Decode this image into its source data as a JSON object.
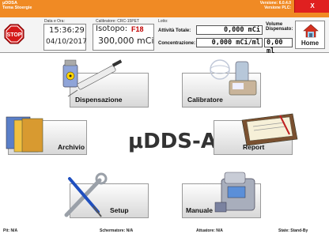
{
  "titlebar": {
    "app_name": "μDDSA",
    "subtitle": "Tema Stoergie",
    "version": "Versione: 6.0.4.0",
    "plc_version": "Versione PLC:",
    "close_label": "X"
  },
  "info": {
    "datetime_label": "Data e Ora:",
    "time": "15:36:29",
    "date": "04/10/2017",
    "calibrator_label": "Calibratore: CRC-15PET",
    "isotope_label": "Isotopo:",
    "isotope_value": "F18",
    "activity": "300,000 mCi",
    "lot_label": "Lotto:",
    "total_activity_label": "Attività Totale:",
    "total_activity_value": "0,000 mCi",
    "volume_label": "Volume Dispensato:",
    "concentration_label": "Concentrazione:",
    "concentration_value": "0,000 mCi/ml",
    "volume_value": "0,00 ml",
    "home_label": "Home"
  },
  "buttons": {
    "dispensazione": "Dispensazione",
    "calibratore": "Calibratore",
    "archivio": "Archivio",
    "report": "Report",
    "setup": "Setup",
    "manuale": "Manuale"
  },
  "brand": "μDDS-A",
  "statusbar": {
    "pit": "Pit: N/A",
    "schermatore": "Schermatore: N/A",
    "attuatore": "Attuatore: N/A",
    "state": "State: Stand-By"
  }
}
